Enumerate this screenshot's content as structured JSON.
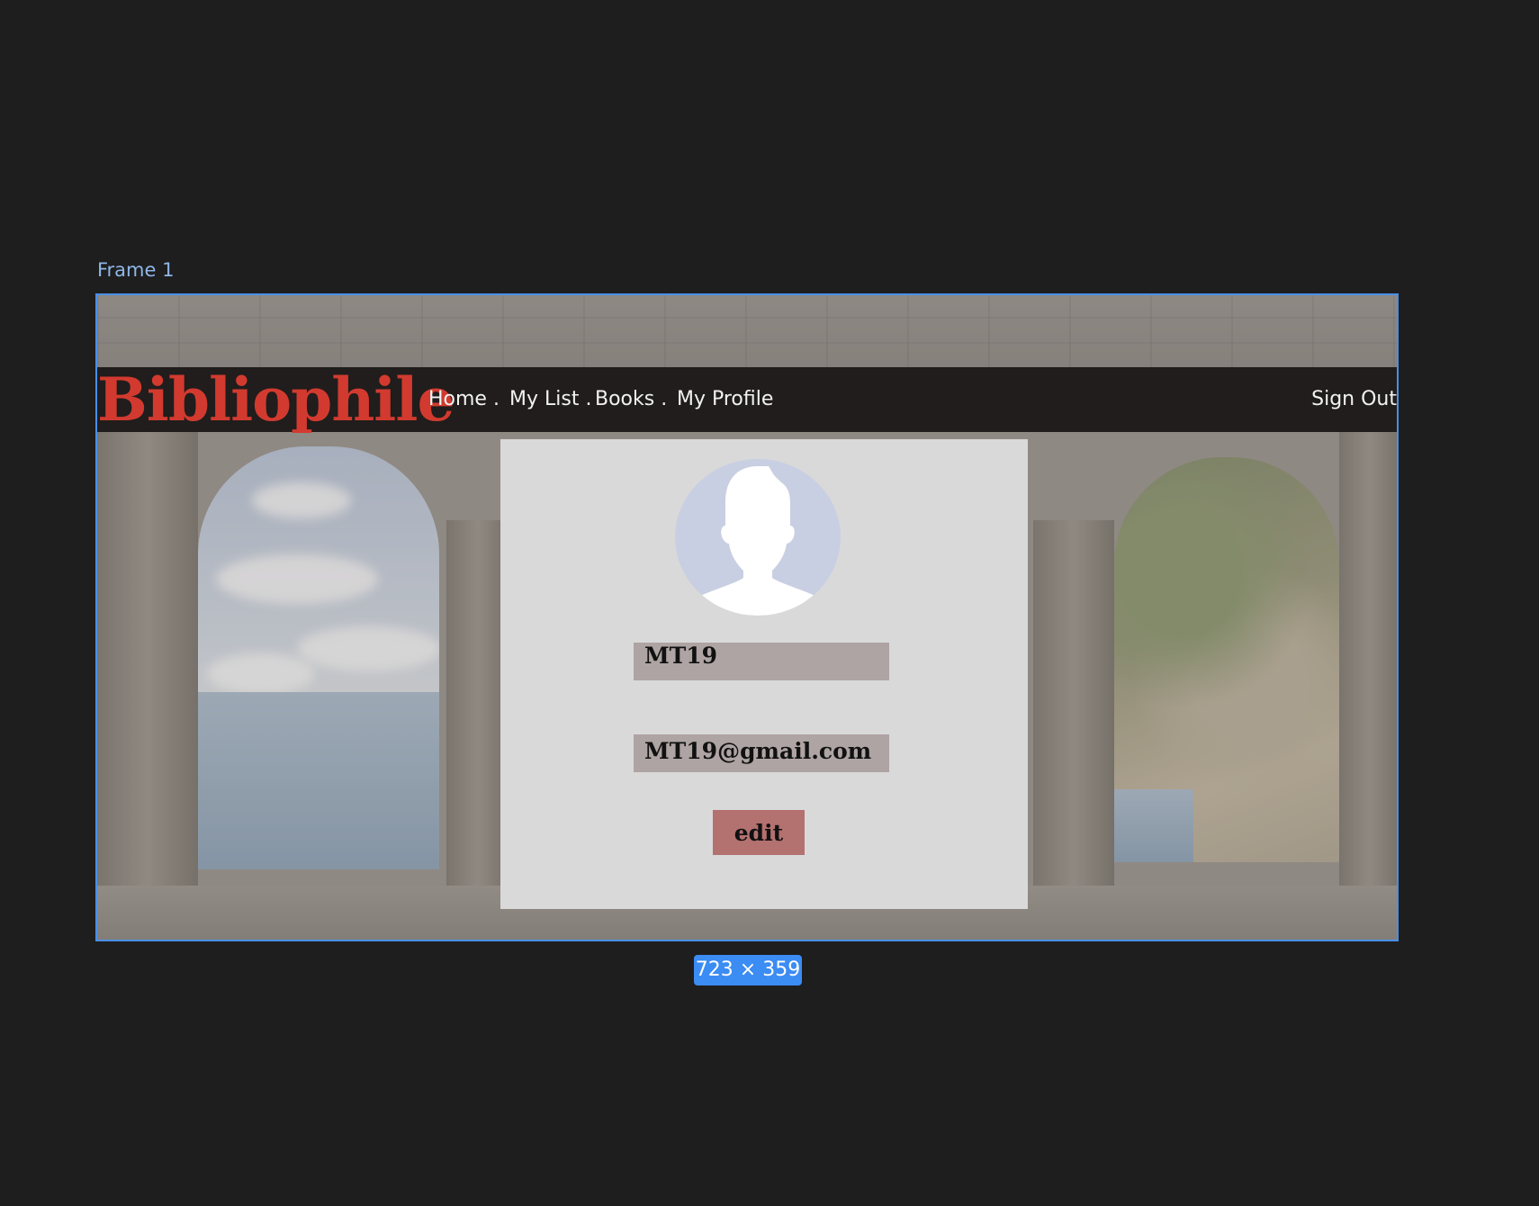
{
  "canvas": {
    "frame_label": "Frame 1",
    "size_badge": "723 × 359",
    "selection_color": "#4a8fe7"
  },
  "navbar": {
    "logo": "Bibliophile",
    "logo_color": "#d23a2f",
    "items": [
      {
        "label": "Home ."
      },
      {
        "label": "My List ."
      },
      {
        "label": "Books ."
      },
      {
        "label": "My Profile"
      }
    ],
    "sign_out": "Sign Out"
  },
  "profile": {
    "avatar_icon": "user-silhouette-icon",
    "username": "MT19",
    "email": "MT19@gmail.com",
    "edit_label": "edit",
    "edit_color": "#b37170"
  },
  "background": {
    "scene": "stone-arches-seaside"
  }
}
